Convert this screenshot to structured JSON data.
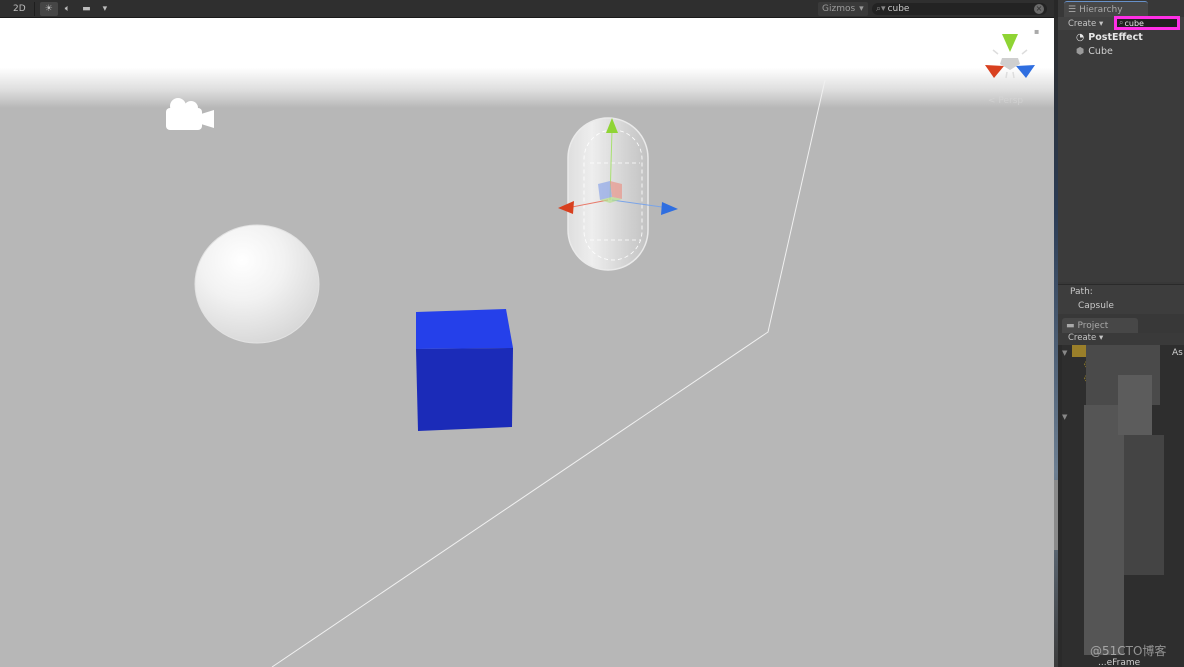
{
  "scene_view": {
    "toolbar": {
      "mode_2d": "2D",
      "lighting_icon": "sun-icon",
      "audio_icon": "speaker-icon",
      "effects_icon": "image-icon",
      "effects_dropdown": "▾",
      "gizmos_label": "Gizmos",
      "gizmos_dropdown": "▾",
      "search_value": "cube",
      "search_icon": "⌕▾",
      "clear_icon": "×"
    },
    "persp_label": "< Persp",
    "objects": [
      "Camera",
      "Sphere",
      "Capsule (selected)",
      "Cube"
    ],
    "colors": {
      "background": "#b7b7b7",
      "cube_front": "#1b2bb8",
      "cube_top": "#2540ea",
      "axis_x": "#d8401f",
      "axis_y": "#8fd434",
      "axis_z": "#2f6ee0"
    }
  },
  "hierarchy": {
    "tab_label": "Hierarchy",
    "create_label": "Create",
    "search_value": "cube",
    "items": [
      {
        "label": "PostEffect",
        "bold": true,
        "icon": "unity-scene-icon"
      },
      {
        "label": "Cube",
        "bold": false,
        "icon": "cube-icon"
      }
    ],
    "path_label": "Path:",
    "path_value": "Capsule",
    "highlight_color": "#ff2fe6"
  },
  "project": {
    "tab_label": "Project",
    "create_label": "Create",
    "asset_column_label": "As",
    "footer_item": "...eFrame"
  },
  "watermark": "@51CTO博客"
}
